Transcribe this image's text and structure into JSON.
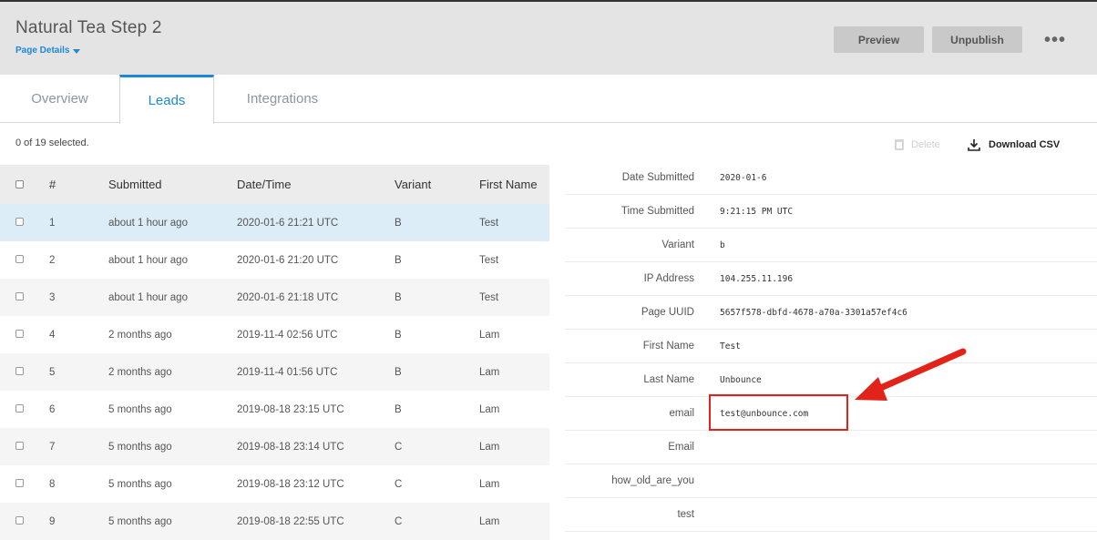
{
  "header": {
    "title": "Natural Tea Step 2",
    "page_details": "Page Details",
    "preview_label": "Preview",
    "unpublish_label": "Unpublish",
    "more_label": "•••"
  },
  "tabs": [
    {
      "label": "Overview"
    },
    {
      "label": "Leads"
    },
    {
      "label": "Integrations"
    }
  ],
  "toolbar": {
    "selected_text": "0 of 19 selected.",
    "delete_label": "Delete",
    "download_label": "Download CSV"
  },
  "table": {
    "columns": [
      "#",
      "Submitted",
      "Date/Time",
      "Variant",
      "First Name"
    ],
    "rows": [
      {
        "num": "1",
        "submitted": "about 1 hour ago",
        "datetime": "2020-01-6 21:21 UTC",
        "variant": "B",
        "first_name": "Test"
      },
      {
        "num": "2",
        "submitted": "about 1 hour ago",
        "datetime": "2020-01-6 21:20 UTC",
        "variant": "B",
        "first_name": "Test"
      },
      {
        "num": "3",
        "submitted": "about 1 hour ago",
        "datetime": "2020-01-6 21:18 UTC",
        "variant": "B",
        "first_name": "Test"
      },
      {
        "num": "4",
        "submitted": "2 months ago",
        "datetime": "2019-11-4 02:56 UTC",
        "variant": "B",
        "first_name": "Lam"
      },
      {
        "num": "5",
        "submitted": "2 months ago",
        "datetime": "2019-11-4 01:56 UTC",
        "variant": "B",
        "first_name": "Lam"
      },
      {
        "num": "6",
        "submitted": "5 months ago",
        "datetime": "2019-08-18 23:15 UTC",
        "variant": "B",
        "first_name": "Lam"
      },
      {
        "num": "7",
        "submitted": "5 months ago",
        "datetime": "2019-08-18 23:14 UTC",
        "variant": "C",
        "first_name": "Lam"
      },
      {
        "num": "8",
        "submitted": "5 months ago",
        "datetime": "2019-08-18 23:12 UTC",
        "variant": "C",
        "first_name": "Lam"
      },
      {
        "num": "9",
        "submitted": "5 months ago",
        "datetime": "2019-08-18 22:55 UTC",
        "variant": "C",
        "first_name": "Lam"
      }
    ]
  },
  "detail": [
    {
      "label": "Date Submitted",
      "value": "2020-01-6"
    },
    {
      "label": "Time Submitted",
      "value": "9:21:15 PM UTC"
    },
    {
      "label": "Variant",
      "value": "b"
    },
    {
      "label": "IP Address",
      "value": "104.255.11.196"
    },
    {
      "label": "Page UUID",
      "value": "5657f578-dbfd-4678-a70a-3301a57ef4c6"
    },
    {
      "label": "First Name",
      "value": "Test"
    },
    {
      "label": "Last Name",
      "value": "Unbounce"
    },
    {
      "label": "email",
      "value": "test@unbounce.com"
    },
    {
      "label": "Email",
      "value": ""
    },
    {
      "label": "how_old_are_you",
      "value": ""
    },
    {
      "label": "test",
      "value": ""
    }
  ],
  "colors": {
    "accent": "#1e88d8",
    "highlight": "#e2231a"
  }
}
